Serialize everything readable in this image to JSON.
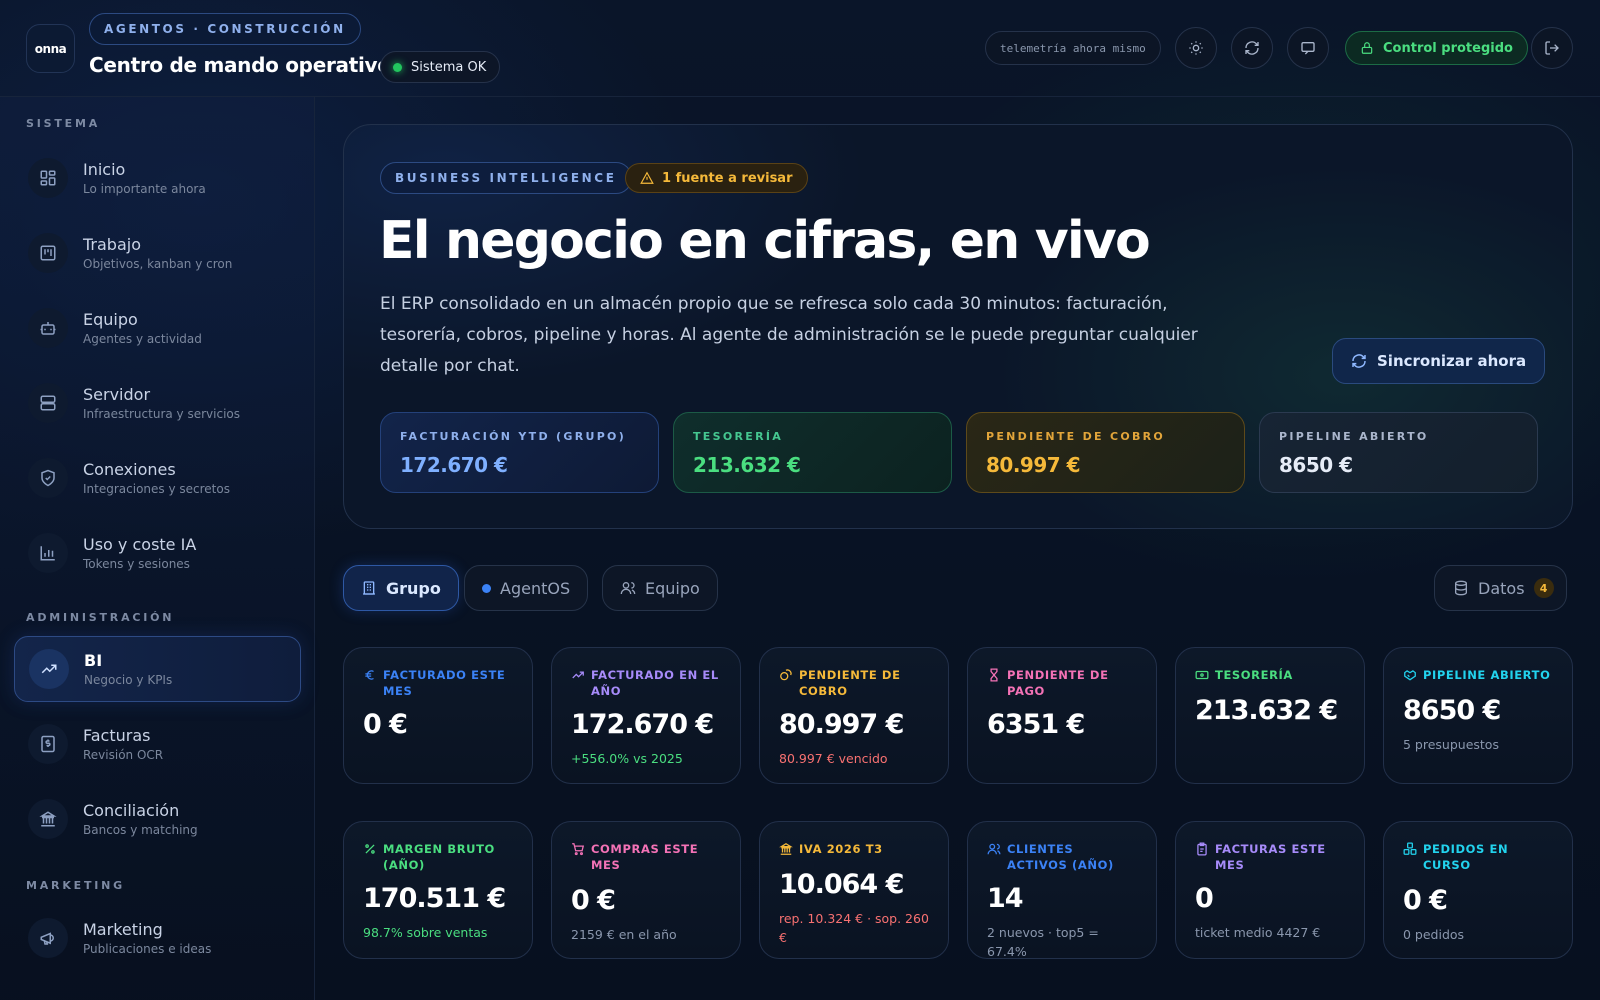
{
  "header": {
    "logo_text": "onna",
    "eyebrow": "AGENTOS · CONSTRUCCIÓN",
    "title": "Centro de mando operativo",
    "status": "Sistema OK",
    "telemetry": "telemetría ahora mismo",
    "control": "Control protegido"
  },
  "sidebar": {
    "sections": [
      "SISTEMA",
      "ADMINISTRACIÓN",
      "MARKETING"
    ],
    "items": [
      {
        "label": "Inicio",
        "sub": "Lo importante ahora",
        "icon": "grid-icon"
      },
      {
        "label": "Trabajo",
        "sub": "Objetivos, kanban y cron",
        "icon": "kanban-icon"
      },
      {
        "label": "Equipo",
        "sub": "Agentes y actividad",
        "icon": "bot-icon"
      },
      {
        "label": "Servidor",
        "sub": "Infraestructura y servicios",
        "icon": "server-icon"
      },
      {
        "label": "Conexiones",
        "sub": "Integraciones y secretos",
        "icon": "shield-icon"
      },
      {
        "label": "Uso y coste IA",
        "sub": "Tokens y sesiones",
        "icon": "bar-chart-icon"
      },
      {
        "label": "BI",
        "sub": "Negocio y KPIs",
        "icon": "trend-up-icon",
        "active": true
      },
      {
        "label": "Facturas",
        "sub": "Revisión OCR",
        "icon": "invoice-icon"
      },
      {
        "label": "Conciliación",
        "sub": "Bancos y matching",
        "icon": "bank-icon"
      },
      {
        "label": "Marketing",
        "sub": "Publicaciones e ideas",
        "icon": "megaphone-icon"
      }
    ]
  },
  "hero": {
    "pill": "BUSINESS INTELLIGENCE",
    "warning": "1 fuente a revisar",
    "title": "El negocio en cifras, en vivo",
    "description": "El ERP consolidado en un almacén propio que se refresca solo cada 30 minutos: facturación, tesorería, cobros, pipeline y horas. Al agente de administración se le puede preguntar cualquier detalle por chat.",
    "sync_label": "Sincronizar ahora",
    "kpis": [
      {
        "label": "FACTURACIÓN YTD (GRUPO)",
        "value": "172.670 €",
        "color": "#7fb0ff"
      },
      {
        "label": "TESORERÍA",
        "value": "213.632 €",
        "color": "#4ade80"
      },
      {
        "label": "PENDIENTE DE COBRO",
        "value": "80.997 €",
        "color": "#f5b93a"
      },
      {
        "label": "PIPELINE ABIERTO",
        "value": "8650 €",
        "color": "#e6ecf7"
      }
    ]
  },
  "tabs": [
    {
      "label": "Grupo",
      "active": true
    },
    {
      "label": "AgentOS"
    },
    {
      "label": "Equipo"
    }
  ],
  "datos": {
    "label": "Datos",
    "count": "4"
  },
  "cards_row1": [
    {
      "label": "FACTURADO ESTE MES",
      "value": "0 €",
      "sub": "",
      "color": "#3b82f6",
      "icon": "euro-icon"
    },
    {
      "label": "FACTURADO EN EL AÑO",
      "value": "172.670 €",
      "sub": "+556.0% vs 2025",
      "sub_color": "#4ade80",
      "color": "#a78bfa",
      "icon": "trend-up-icon"
    },
    {
      "label": "PENDIENTE DE COBRO",
      "value": "80.997 €",
      "sub": "80.997 € vencido",
      "sub_color": "#f87171",
      "color": "#f5b93a",
      "icon": "coins-icon"
    },
    {
      "label": "PENDIENTE DE PAGO",
      "value": "6351 €",
      "sub": "",
      "color": "#f472b6",
      "icon": "hourglass-icon"
    },
    {
      "label": "TESORERÍA",
      "value": "213.632 €",
      "sub": "",
      "color": "#4ade80",
      "icon": "cash-icon"
    },
    {
      "label": "PIPELINE ABIERTO",
      "value": "8650 €",
      "sub": "5 presupuestos",
      "sub_color": "#8a97ad",
      "color": "#22d3ee",
      "icon": "handshake-icon"
    }
  ],
  "cards_row2": [
    {
      "label": "MARGEN BRUTO (AÑO)",
      "value": "170.511 €",
      "sub": "98.7% sobre ventas",
      "sub_color": "#4ade80",
      "color": "#4ade80",
      "icon": "percent-icon"
    },
    {
      "label": "COMPRAS ESTE MES",
      "value": "0 €",
      "sub": "2159 € en el año",
      "sub_color": "#8a97ad",
      "color": "#f472b6",
      "icon": "cart-icon"
    },
    {
      "label": "IVA 2026 T3",
      "value": "10.064 €",
      "sub": "rep. 10.324 € · sop. 260 €",
      "sub_color": "#f87171",
      "color": "#f5b93a",
      "icon": "landmark-icon"
    },
    {
      "label": "CLIENTES ACTIVOS (AÑO)",
      "value": "14",
      "sub": "2 nuevos · top5 = 67.4%",
      "sub_color": "#8a97ad",
      "color": "#3b82f6",
      "icon": "users-icon"
    },
    {
      "label": "FACTURAS ESTE MES",
      "value": "0",
      "sub": "ticket medio 4427 €",
      "sub_color": "#8a97ad",
      "color": "#a78bfa",
      "icon": "clipboard-icon"
    },
    {
      "label": "PEDIDOS EN CURSO",
      "value": "0 €",
      "sub": "0 pedidos",
      "sub_color": "#8a97ad",
      "color": "#22d3ee",
      "icon": "boxes-icon"
    }
  ]
}
